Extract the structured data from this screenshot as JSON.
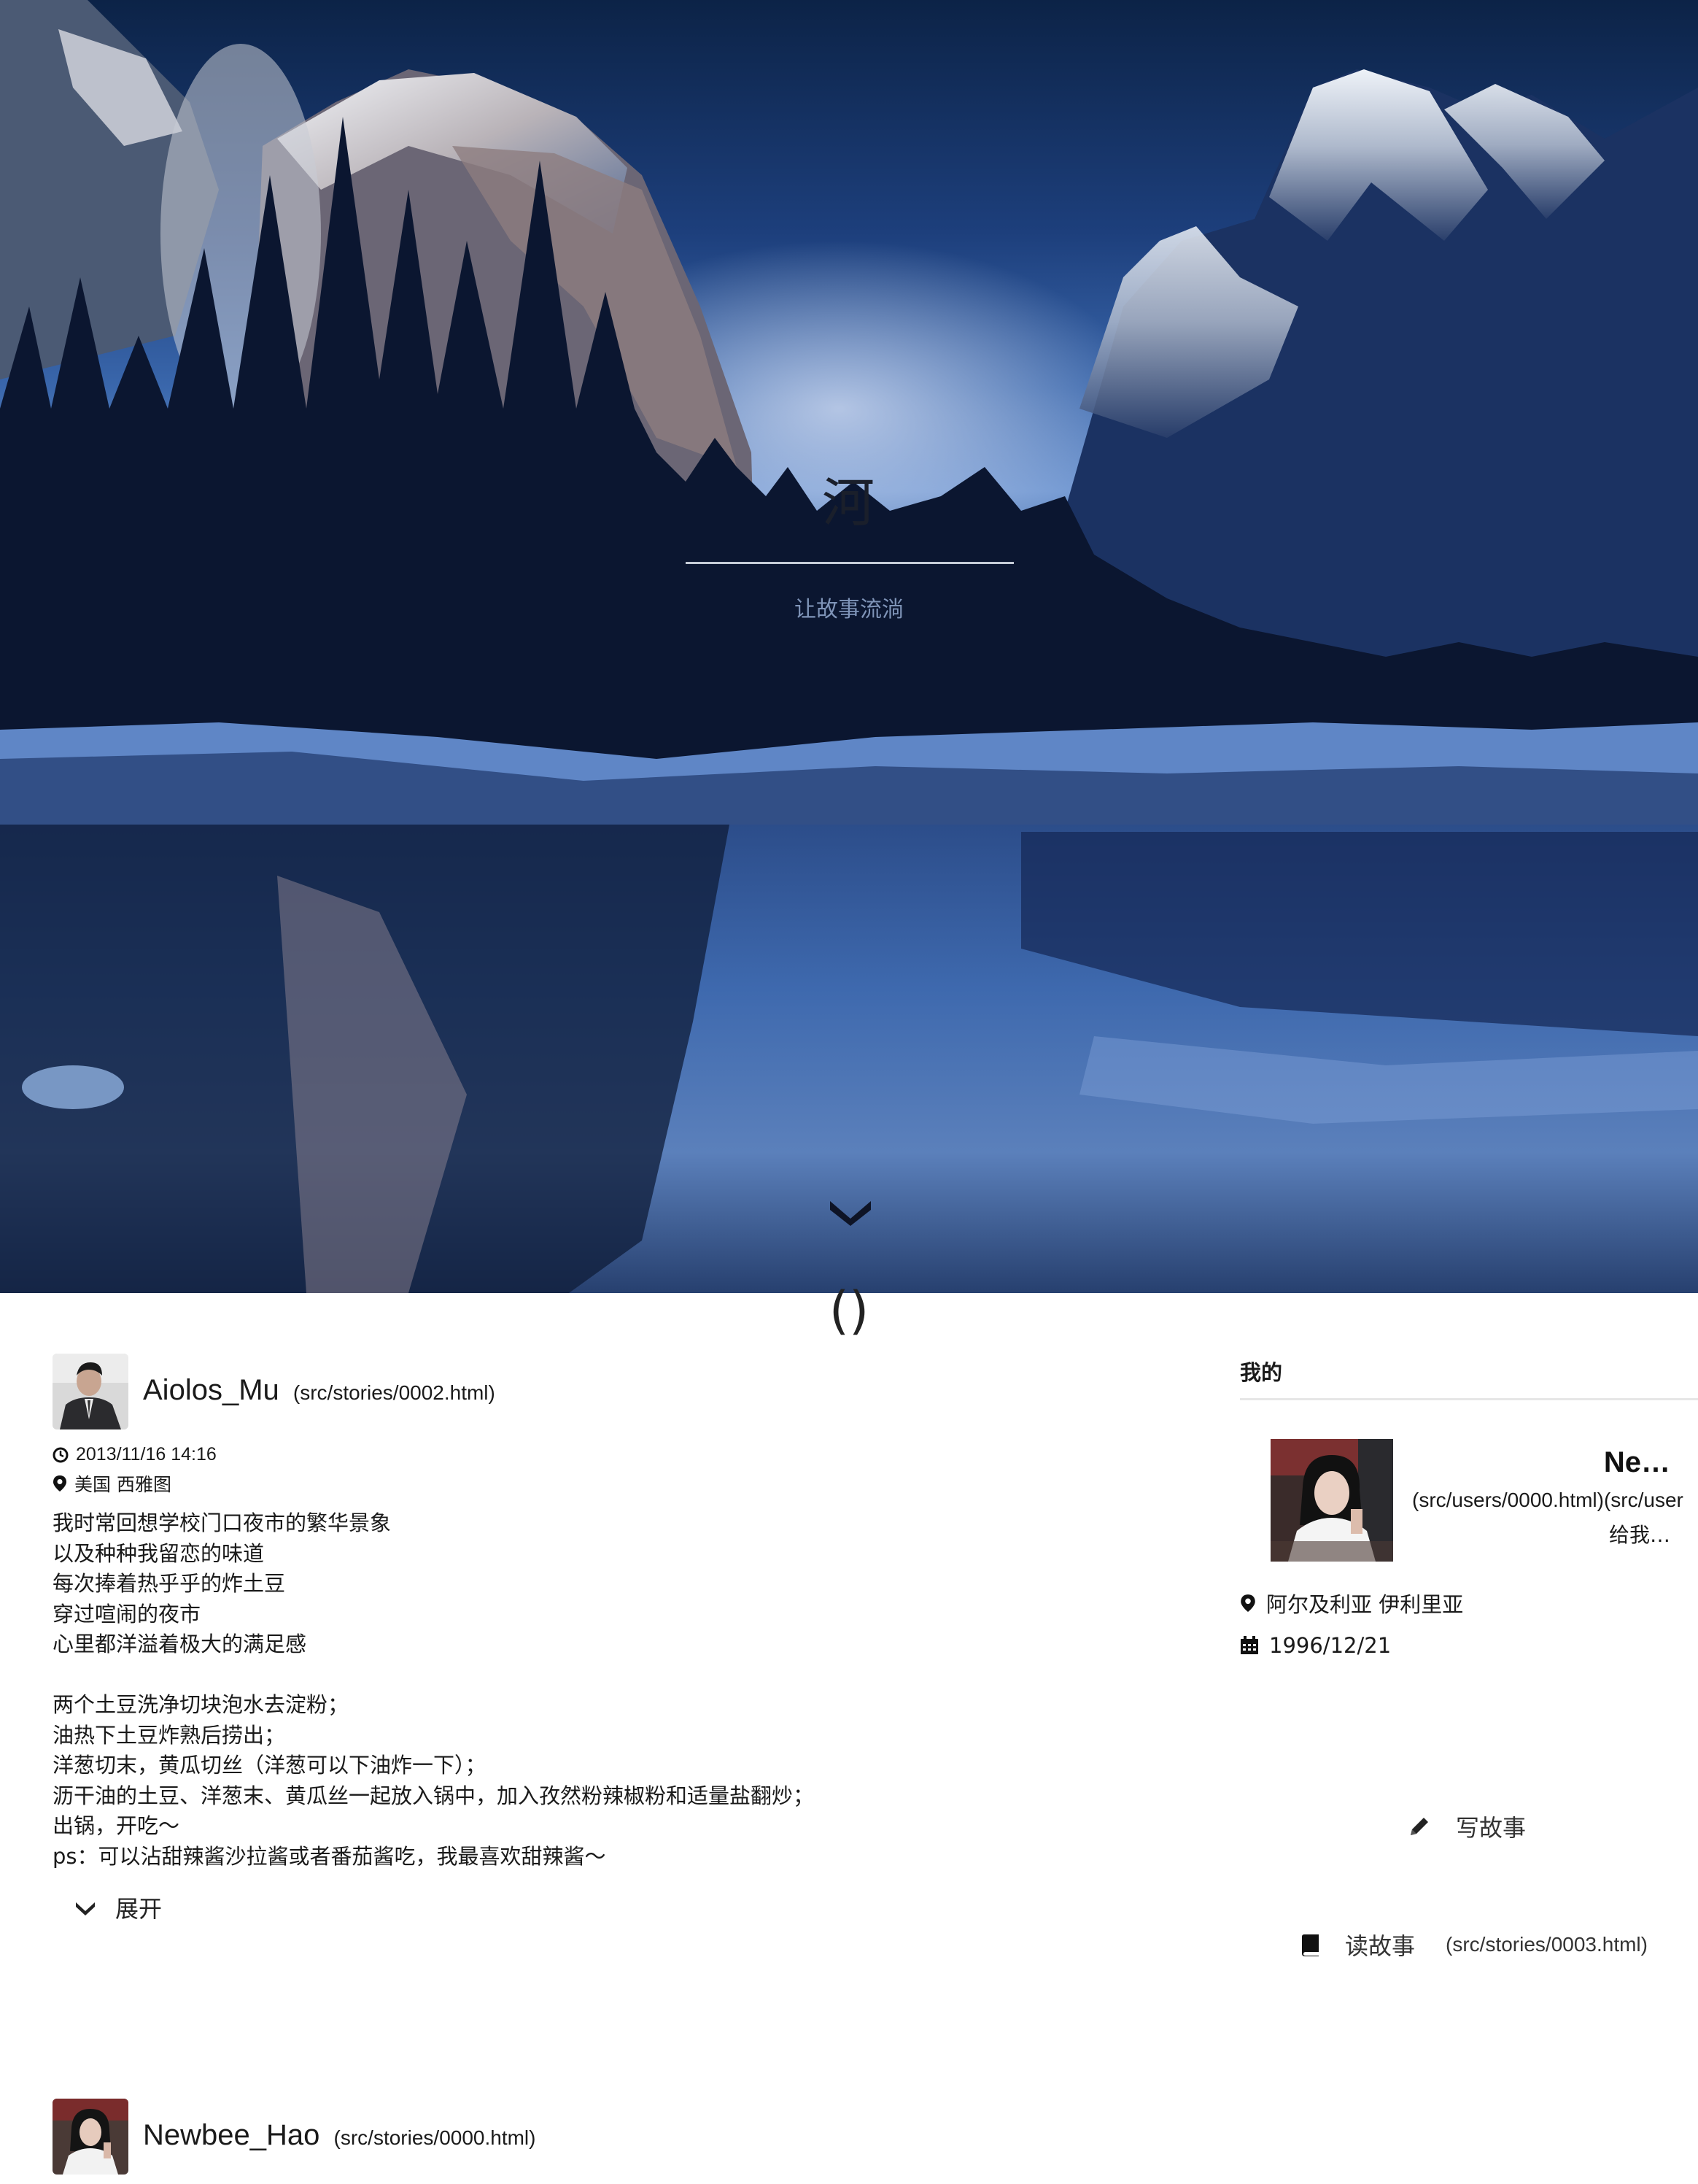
{
  "hero": {
    "title": "河",
    "subtitle": "让故事流淌",
    "scroll_marker": "()"
  },
  "stories": [
    {
      "author": "Aiolos_Mu",
      "link": "(src/stories/0002.html)",
      "datetime": "2013/11/16 14:16",
      "location": "美国 西雅图",
      "body": "我时常回想学校门口夜市的繁华景象\n以及种种我留恋的味道\n每次捧着热乎乎的炸土豆\n穿过喧闹的夜市\n心里都洋溢着极大的满足感\n\n两个土豆洗净切块泡水去淀粉；\n油热下土豆炸熟后捞出；\n洋葱切末，黄瓜切丝（洋葱可以下油炸一下）；\n沥干油的土豆、洋葱末、黄瓜丝一起放入锅中，加入孜然粉辣椒粉和适量盐翻炒；\n出锅，开吃～\nps：可以沾甜辣酱沙拉酱或者番茄酱吃，我最喜欢甜辣酱～",
      "expand_label": "展开"
    },
    {
      "author": "Newbee_Hao",
      "link": "(src/stories/0000.html)"
    }
  ],
  "sidebar": {
    "title": "我的",
    "profile": {
      "name": "Ne…",
      "link_primary": "(src/users/0000.html)",
      "link_secondary": "(src/user",
      "bio": "给我…",
      "location": "阿尔及利亚 伊利里亚",
      "birthday": "1996/12/21"
    },
    "actions": {
      "write_label": "写故事",
      "read_label": "读故事",
      "read_link": "(src/stories/0003.html)"
    }
  },
  "icons": {
    "scroll": "chevron-down-icon",
    "time": "clock-icon",
    "place": "map-marker-icon",
    "calendar": "calendar-icon",
    "write": "pencil-icon",
    "read": "book-icon"
  }
}
